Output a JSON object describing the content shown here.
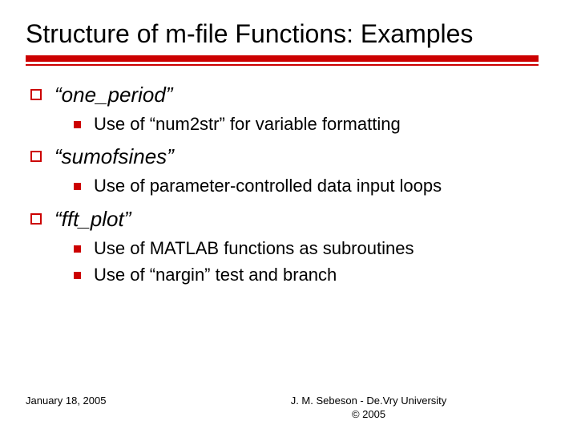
{
  "title": "Structure of m-file Functions: Examples",
  "items": [
    {
      "label": "“one_period”",
      "sub": [
        "Use of “num2str” for variable formatting"
      ]
    },
    {
      "label": "“sumofsines”",
      "sub": [
        "Use of parameter-controlled data input loops"
      ]
    },
    {
      "label": "“fft_plot”",
      "sub": [
        "Use of MATLAB functions as subroutines",
        "Use of “nargin” test and branch"
      ]
    }
  ],
  "footer": {
    "date": "January 18, 2005",
    "author": "J. M. Sebeson - De.Vry University",
    "copyright": "© 2005"
  }
}
